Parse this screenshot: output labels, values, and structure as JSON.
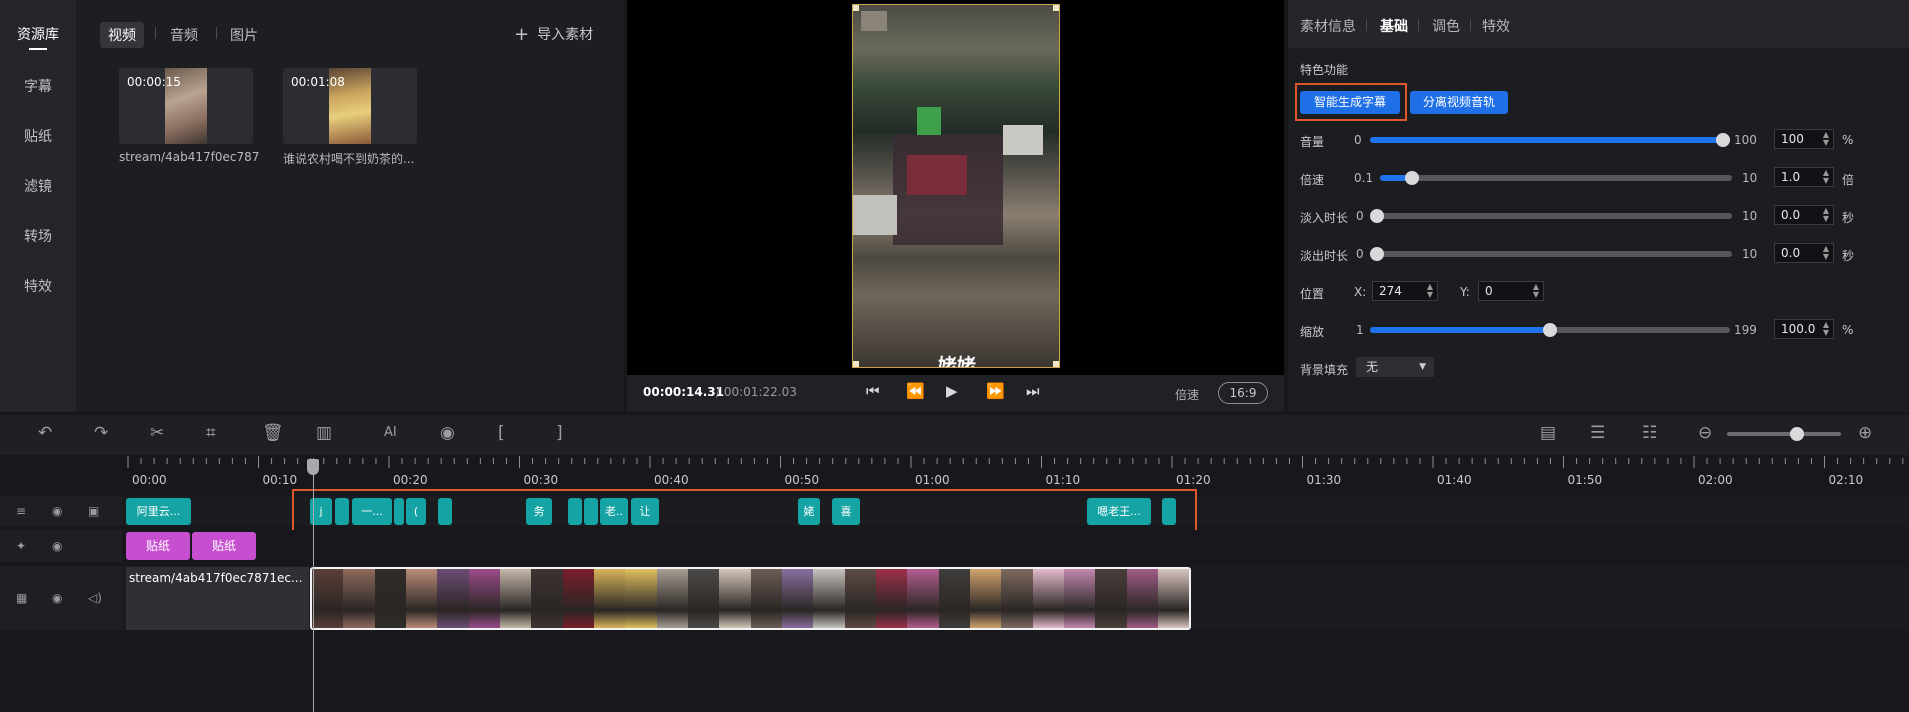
{
  "rail": {
    "items": [
      "资源库",
      "字幕",
      "贴纸",
      "滤镜",
      "转场",
      "特效"
    ],
    "active": "资源库"
  },
  "assets": {
    "tabs": [
      "视频",
      "音频",
      "图片"
    ],
    "import_label": "导入素材",
    "items": [
      {
        "duration": "00:00:15",
        "name": "stream/4ab417f0ec787..."
      },
      {
        "duration": "00:01:08",
        "name": "谁说农村喝不到奶茶的..."
      }
    ]
  },
  "preview": {
    "caption": "姥姥",
    "current_time": "00:00:14.31",
    "total_time": "/ 00:01:22.03",
    "speed_label": "倍速",
    "ratio": "16:9"
  },
  "props": {
    "tabs": [
      "素材信息",
      "基础",
      "调色",
      "特效"
    ],
    "active_tab": "基础",
    "feature_title": "特色功能",
    "btn_subtitle": "智能生成字幕",
    "btn_split_audio": "分离视频音轨",
    "volume": {
      "label": "音量",
      "min": "0",
      "max": "100",
      "value": "100",
      "unit": "%",
      "fraction": 1.0
    },
    "speed": {
      "label": "倍速",
      "min": "0.1",
      "max": "10",
      "value": "1.0",
      "unit": "倍",
      "fraction": 0.09
    },
    "fade_in": {
      "label": "淡入时长",
      "min": "0",
      "max": "10",
      "value": "0.0",
      "unit": "秒",
      "fraction": 0.0
    },
    "fade_out": {
      "label": "淡出时长",
      "min": "0",
      "max": "10",
      "value": "0.0",
      "unit": "秒",
      "fraction": 0.0
    },
    "position": {
      "label": "位置",
      "x_label": "X:",
      "x": "274",
      "y_label": "Y:",
      "y": "0"
    },
    "scale": {
      "label": "缩放",
      "min": "1",
      "max": "199",
      "value": "100.0",
      "unit": "%",
      "fraction": 0.5
    },
    "bg_fill": {
      "label": "背景填充",
      "value": "无"
    }
  },
  "timeline": {
    "ticks": [
      "00:00",
      "00:10",
      "00:20",
      "00:30",
      "00:40",
      "00:50",
      "01:00",
      "01:10",
      "01:20",
      "01:30",
      "01:40",
      "01:50",
      "02:00",
      "02:10"
    ],
    "subtitle_clips": [
      "阿里云...",
      "j",
      "",
      "一...",
      "",
      "(",
      "",
      "务",
      "",
      "",
      "老..",
      "让",
      "姥",
      "喜",
      "嗯老王...",
      ""
    ],
    "stickers": [
      "贴纸",
      "贴纸"
    ],
    "video_clip": "stream/4ab417f0ec7871ec..."
  },
  "colors": {
    "accent": "#1f6fe6",
    "subtitle_clip": "#16a3a3",
    "sticker": "#c64fcf",
    "highlight": "#e2562c"
  }
}
